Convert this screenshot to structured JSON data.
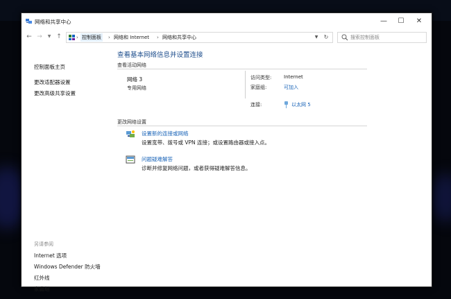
{
  "window": {
    "title": "网络和共享中心"
  },
  "controls": {
    "minimize": "—",
    "maximize": "☐",
    "close": "✕"
  },
  "nav": {
    "back": "←",
    "forward": "→",
    "recent": "▼",
    "up": "↑"
  },
  "address": {
    "crumbs": [
      "控制面板",
      "网络和 Internet",
      "网络和共享中心"
    ],
    "separator": "›",
    "dropdown": "▼",
    "refresh": "↻"
  },
  "search": {
    "placeholder": "搜索控制面板"
  },
  "sidebar": {
    "links": [
      "控制面板主页",
      "更改适配器设置",
      "更改高级共享设置"
    ],
    "see_also_heading": "另请参阅",
    "see_also": [
      "Internet 选项",
      "Windows Defender 防火墙",
      "红外线",
      "家庭组"
    ]
  },
  "main": {
    "title": "查看基本网络信息并设置连接",
    "active_networks_heading": "查看活动网络",
    "network": {
      "name": "网络  3",
      "type": "专用网络",
      "access_type_label": "访问类型:",
      "access_type_value": "Internet",
      "homegroup_label": "家庭组:",
      "homegroup_value": "可加入",
      "connection_label": "连接:",
      "connection_value": "以太网 5"
    },
    "change_settings_heading": "更改网络设置",
    "tasks": [
      {
        "link": "设置新的连接或网络",
        "desc": "设置宽带、拨号或 VPN 连接；或设置路由器或接入点。"
      },
      {
        "link": "问题疑难解答",
        "desc": "诊断并修复网络问题，或者获得疑难解答信息。"
      }
    ]
  },
  "colors": {
    "link": "#1a64b8",
    "title": "#1e4e8c",
    "background": "#05070d"
  }
}
